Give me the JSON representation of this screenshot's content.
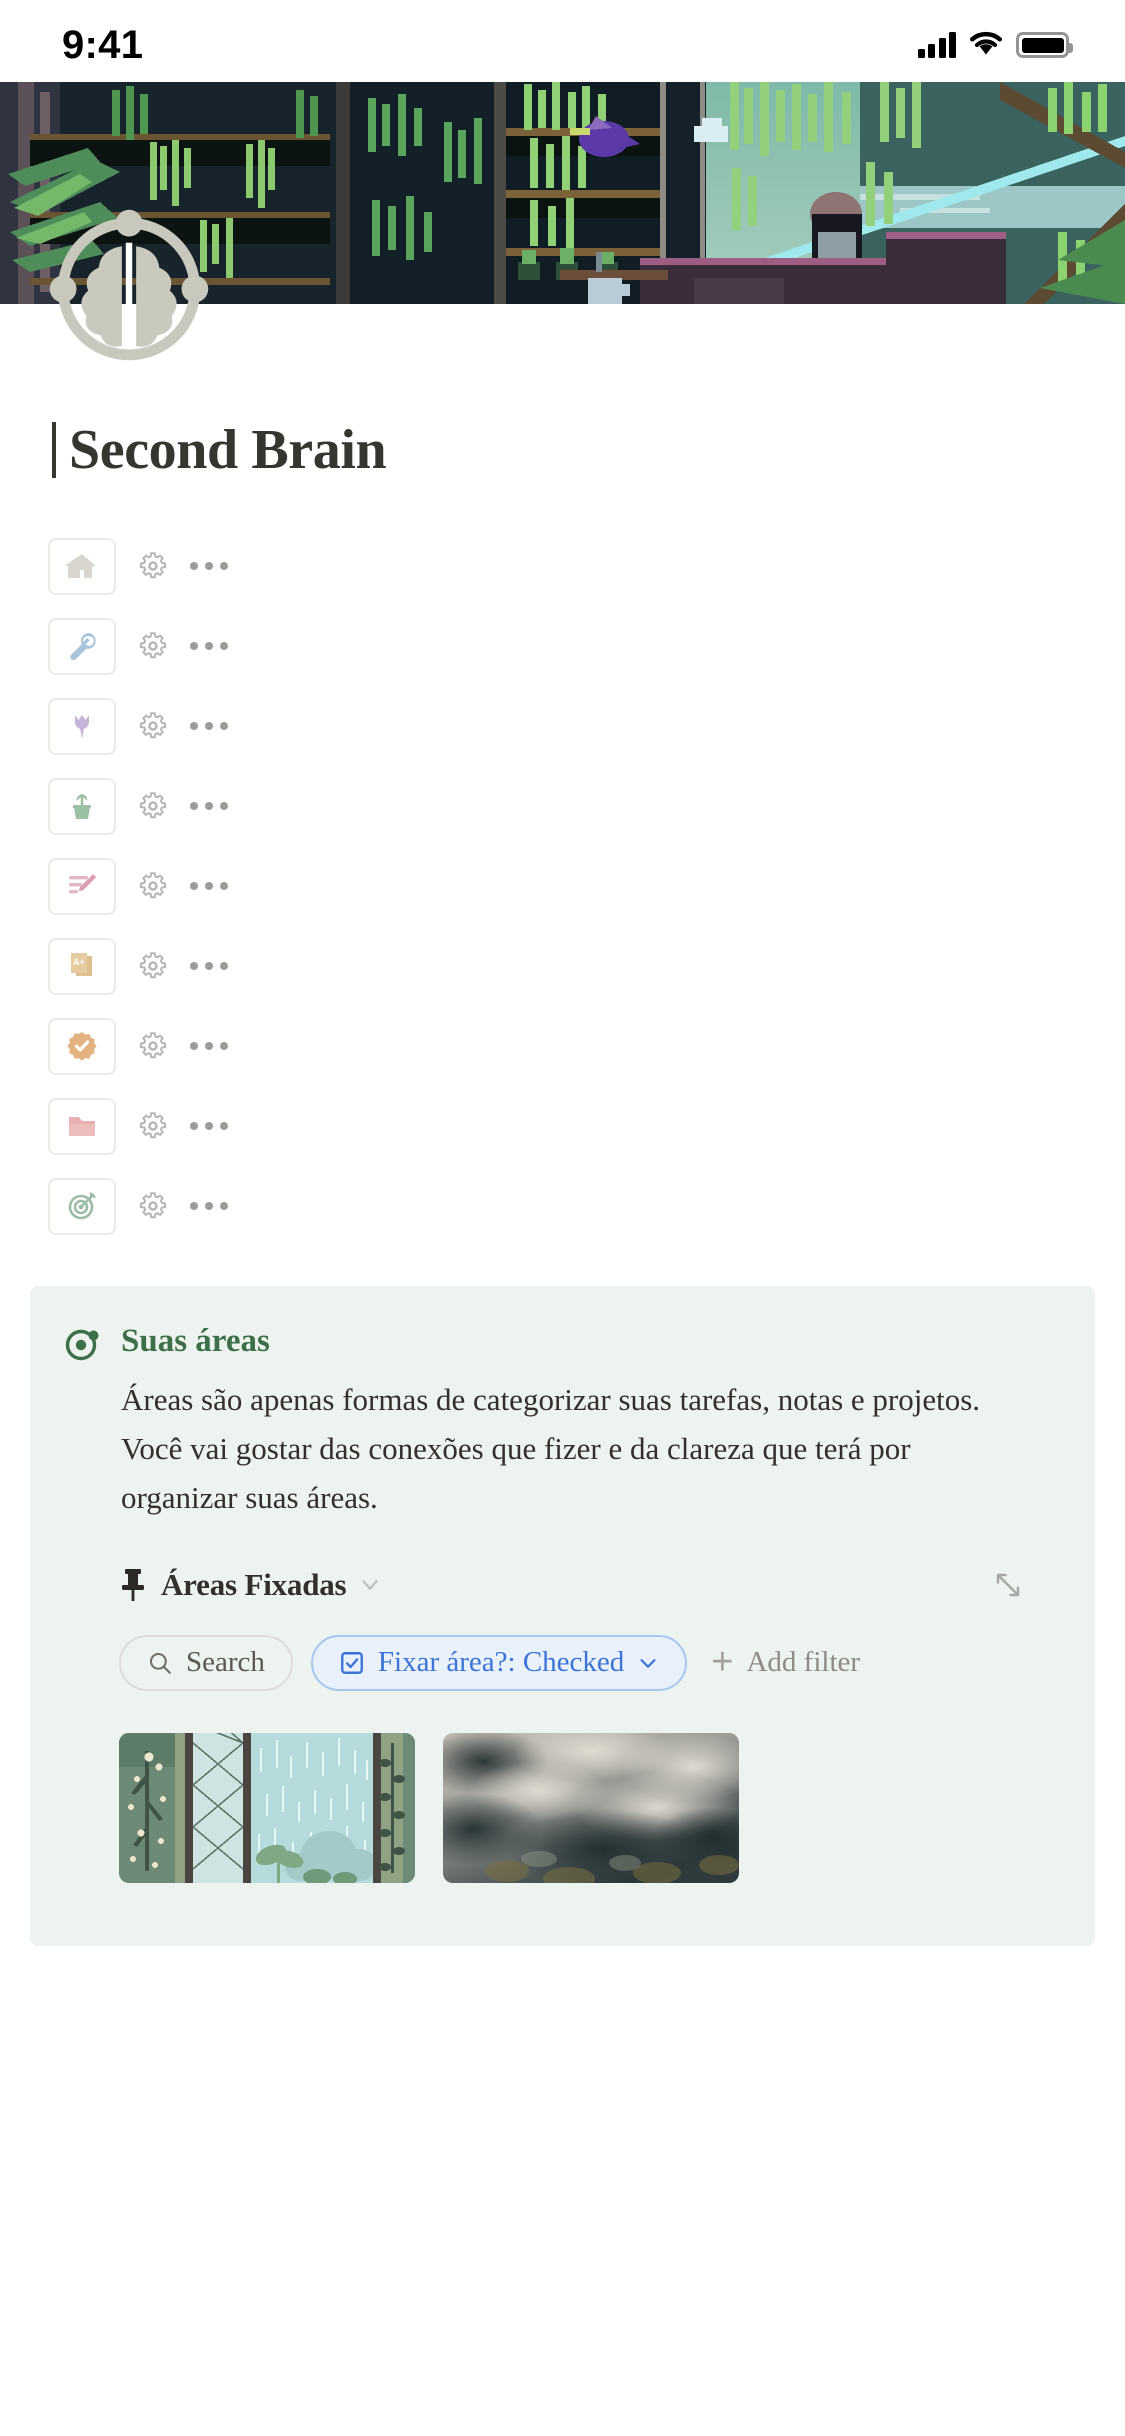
{
  "status_bar": {
    "time": "9:41",
    "cellular_icon": "signal-bars-icon",
    "wifi_icon": "wifi-icon",
    "battery_icon": "battery-icon"
  },
  "cover": {
    "icon_name": "cover-image",
    "description": "pixel-art jungle greenhouse scene"
  },
  "page": {
    "icon_name": "brain-icon",
    "title": "Second Brain"
  },
  "icon_rows": [
    {
      "icon": "house-icon",
      "color": "#d8d6cf",
      "gear": "gear-icon",
      "more": "more-options-icon"
    },
    {
      "icon": "wrench-icon",
      "color": "#a9c3d8",
      "gear": "gear-icon",
      "more": "more-options-icon"
    },
    {
      "icon": "tulip-icon",
      "color": "#c5b3d8",
      "gear": "gear-icon",
      "more": "more-options-icon"
    },
    {
      "icon": "potted-plant-icon",
      "color": "#9cc0a4",
      "gear": "gear-icon",
      "more": "more-options-icon"
    },
    {
      "icon": "memo-pencil-icon",
      "color": "#e2b6c4",
      "gear": "gear-icon",
      "more": "more-options-icon"
    },
    {
      "icon": "a-plus-paper-icon",
      "color": "#e2c79c",
      "gear": "gear-icon",
      "more": "more-options-icon"
    },
    {
      "icon": "check-badge-icon",
      "color": "#e3b27f",
      "gear": "gear-icon",
      "more": "more-options-icon"
    },
    {
      "icon": "folder-icon",
      "color": "#e8b0b0",
      "gear": "gear-icon",
      "more": "more-options-icon"
    },
    {
      "icon": "target-dart-icon",
      "color": "#9bbda6",
      "gear": "gear-icon",
      "more": "more-options-icon"
    }
  ],
  "callout": {
    "icon_name": "record-target-icon",
    "title": "Suas áreas",
    "text": "Áreas são apenas formas de categorizar suas tarefas, notas e projetos. Você vai gostar das conexões que fizer e da clareza que terá por organizar suas áreas.",
    "accent_color": "#3d7048",
    "background_color": "#edf3ee"
  },
  "pinned": {
    "pin_icon": "pushpin-icon",
    "label": "Áreas Fixadas",
    "chevron_icon": "chevron-down-icon",
    "expand_icon": "expand-diagonal-icon"
  },
  "filters": {
    "search_icon": "search-icon",
    "search_label": "Search",
    "active_filter": {
      "checkbox_icon": "checkbox-checked-icon",
      "label": "Fixar área?: Checked",
      "chevron_icon": "chevron-down-icon",
      "color": "#3b74d4",
      "background_color": "#e9f1fc"
    },
    "add_filter_label": "Add filter",
    "add_filter_icon": "plus-icon"
  },
  "cards": [
    {
      "name": "card-rainy-window",
      "description": "pixel-art rainy window with plants"
    },
    {
      "name": "card-misty-mountain",
      "description": "misty mountain photo"
    }
  ]
}
